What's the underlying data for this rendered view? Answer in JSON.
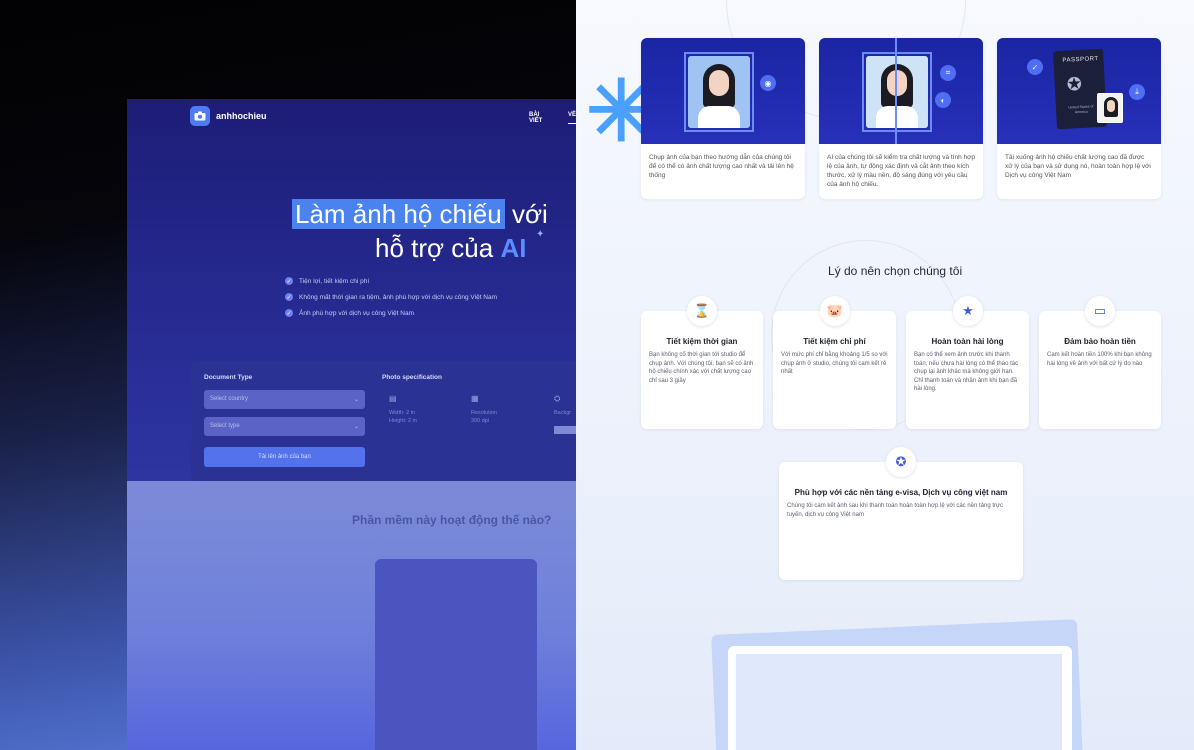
{
  "left": {
    "logo": {
      "text": "anhhochieu"
    },
    "nav": {
      "items": [
        "BÀI VIẾT",
        "VỀ"
      ]
    },
    "hero": {
      "highlight": "Làm ảnh hộ chiếu",
      "line1_rest": "với",
      "line2_prefix": "hỗ trợ của",
      "ai": "AI"
    },
    "bullets": [
      "Tiện lợi, tiết kiệm chi phí",
      "Không mất thời gian ra tiệm, ảnh phù hợp với dịch vụ công Việt Nam",
      "Ảnh phù hợp với dịch vụ công Việt Nam"
    ],
    "form": {
      "document_type_label": "Document Type",
      "country_placeholder": "Select country",
      "type_placeholder": "Select type",
      "upload_label": "Tải lên ảnh của bạn",
      "photo_spec_label": "Photo specification",
      "width": "Width: 2 in",
      "height": "Height: 2 in",
      "resolution_label": "Resolution",
      "resolution_value": "300 dpi",
      "background_label": "Backgr"
    },
    "how_title": "Phần mềm này hoạt động thế nào?"
  },
  "right": {
    "steps": [
      {
        "text": "Chụp ảnh của bạn theo hướng dẫn của chúng tôi để có thể có ảnh chất lượng cao nhất và tải lên hệ thống"
      },
      {
        "text": "AI của chúng tôi sẽ kiểm tra chất lượng và tính hợp lệ của ảnh, tự động xác định và cắt ảnh theo kích thước, xử lý màu nền, độ sáng đúng với yêu cầu của ảnh hộ chiếu."
      },
      {
        "text": "Tải xuống ảnh hộ chiếu chất lượng cao đã được xử lý của bạn và sử dụng nó, hoàn toàn hợp lệ với Dịch vụ công Việt Nam"
      }
    ],
    "passport": {
      "title": "PASSPORT",
      "issuer": "United States of America"
    },
    "why_title": "Lý do nên chọn chúng tôi",
    "reasons": [
      {
        "title": "Tiết kiệm thời gian",
        "desc": "Bạn không cố thời gian tới studio để chụp ảnh. Với chúng tôi, bạn sẽ có ảnh hộ chiếu chính xác với chất lượng cao chỉ sau 3 giây"
      },
      {
        "title": "Tiết kiệm chi phí",
        "desc": "Với mức phí chỉ bằng khoảng 1/5 so với chụp ảnh ở studio, chúng tôi cam kết rẻ nhất"
      },
      {
        "title": "Hoàn toàn hài lòng",
        "desc": "Bạn có thể xem ảnh trước khi thanh toán, nếu chưa hài lòng có thể thao tác chụp lại ảnh khác mà không giới hạn. Chỉ thanh toán và nhận ảnh khi bạn đã hài lòng."
      },
      {
        "title": "Đảm bảo hoàn tiền",
        "desc": "Cam kết hoàn tiền 100% khi bạn không hài lòng về ảnh với bất cứ lý do nào"
      },
      {
        "title": "Phù hợp với các nền tảng e-visa, Dịch vụ công việt nam",
        "desc": "Chúng tôi cam kết ảnh sau khi thanh toán hoàn toàn hợp lệ với các nền tảng trực tuyến, dịch vụ công Việt nam"
      }
    ]
  },
  "colors": {
    "brand": "#4f7cf5",
    "hero_bg": "#1d1d77",
    "card_bg": "#1a25a3"
  }
}
